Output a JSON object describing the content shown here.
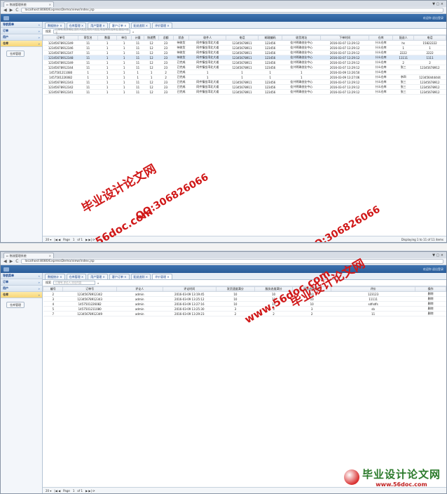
{
  "browser": {
    "tab_title": "物流管理系统",
    "tab_close": "×",
    "win_controls": "▼ ▢ ×",
    "back": "◀",
    "forward": "▶",
    "reload": "C",
    "url": "localhost:8080/ExpressDemo/view/index.jsp"
  },
  "app": {
    "top_right": "欢迎你 退出登录"
  },
  "sidebar": {
    "items": [
      {
        "label": "导航菜单",
        "arrow": "«"
      },
      {
        "label": "订单",
        "arrow": "»"
      },
      {
        "label": "用户",
        "arrow": "»"
      },
      {
        "label": "仓库",
        "arrow": "»"
      }
    ],
    "button": "仓库管理"
  },
  "screen1": {
    "tabs": [
      "数据统计 ×",
      "仓库管理 ×",
      "用户管理 ×",
      "客户订单 ×",
      "配送追踪 ×",
      "评价管理 ×"
    ],
    "search_label": "搜索",
    "search_placeholder": "订单号,收货地址,发件人姓名,收件人姓名,电话号码,仓库名,配送人姓名",
    "columns": [
      "订单号",
      "寄货名",
      "数量",
      "单位",
      "计量",
      "快递费",
      "总额",
      "状态",
      "收件人",
      "电话",
      "邮政编码",
      "收货地址",
      "下单时间",
      "仓库",
      "配送人",
      "电话"
    ],
    "rows": [
      [
        "12345678912349",
        "11",
        "1",
        "1",
        "11",
        "12",
        "23",
        "待收货",
        "同齐镇金湾北大道",
        "12345678911",
        "123456",
        "佳兴明珠创业中心 ",
        "2016-03-07 13:29:12",
        "什么仓库",
        "hs",
        "15822222"
      ],
      [
        "12345678912346",
        "11",
        "1",
        "1",
        "11",
        "12",
        "23",
        "待收货",
        "同齐镇金湾北大道",
        "12345678911",
        "123456",
        "佳兴明珠创业中心 ",
        "2016-03-07 13:29:12",
        "什么仓库",
        "1",
        "1"
      ],
      [
        "12345678912347",
        "11",
        "1",
        "1",
        "11",
        "12",
        "23",
        "待收货",
        "同齐镇金湾北大道",
        "12345678911",
        "123456",
        "佳兴明珠创业中心 ",
        "2016-03-07 13:29:12",
        "什么仓库",
        "2222",
        "2222"
      ],
      [
        "12345678912348",
        "11",
        "1",
        "1",
        "11",
        "12",
        "23",
        "待收货",
        "同齐镇金湾北大道",
        "12345678911",
        "123456",
        "佳兴明珠创业中心 ",
        "2016-03-07 13:29:12",
        "什么仓库",
        "11111",
        "1111"
      ],
      [
        "12345678912349",
        "11",
        "1",
        "1",
        "11",
        "12",
        "23",
        "已完成",
        "同齐镇金湾北大道",
        "12345678911",
        "123456",
        "佳兴明珠创业中心 ",
        "2016-03-07 13:29:12",
        "什么仓库",
        "2",
        "2"
      ],
      [
        "12345678912344",
        "11",
        "1",
        "1",
        "11",
        "12",
        "23",
        "已完成",
        "同齐镇金湾北大道",
        "12345678911",
        "123456",
        "佳兴明珠创业中心 ",
        "2016-03-07 13:29:12",
        "什么仓库",
        "张三",
        "12345678912"
      ],
      [
        "1457501211080",
        "1",
        "1",
        "1",
        "1",
        "1",
        "2",
        "已完成",
        "1",
        "1",
        "1",
        "1",
        "2016-03-09 13:26:50",
        "什么仓库",
        "",
        ""
      ],
      [
        "1457501226082",
        "1",
        "1",
        "1",
        "1",
        "1",
        "2",
        "已完成",
        "1",
        "1",
        "1",
        "1",
        "2016-03-09 13:27:06",
        "什么仓库",
        "李四",
        "123456444444"
      ],
      [
        "12345678912343",
        "11",
        "1",
        "1",
        "11",
        "12",
        "23",
        "已完成",
        "同齐镇金湾北大道",
        "12345678911",
        "123456",
        "佳兴明珠创业中心 ",
        "2016-03-07 13:29:12",
        "什么仓库",
        "张三",
        "12345678912"
      ],
      [
        "12345678912342",
        "11",
        "1",
        "1",
        "11",
        "12",
        "23",
        "已完成",
        "同齐镇金湾北大道",
        "12345678911",
        "123456",
        "佳兴明珠创业中心 ",
        "2016-03-07 13:29:12",
        "什么仓库",
        "张三",
        "12345678912"
      ],
      [
        "12345678912341",
        "11",
        "1",
        "1",
        "11",
        "12",
        "23",
        "已完成",
        "同齐镇金湾北大道",
        "12345678911",
        "123456",
        "佳兴明珠创业中心 ",
        "2016-03-07 13:29:12",
        "什么仓库",
        "张三",
        "12345678912"
      ]
    ],
    "pager": {
      "size": "20 ▾",
      "nav": "|◀ ◀",
      "page_label": "Page",
      "page_value": "1",
      "of": "of 1",
      "nav2": "▶ ▶| ⟳",
      "display": "Displaying 1 to 11 of 11 items"
    }
  },
  "screen2": {
    "tabs": [
      "数据统计 ×",
      "仓库管理 ×",
      "用户管理 ×",
      "客户订单 ×",
      "配送追踪 ×",
      "评价管理 ×"
    ],
    "search_label": "搜索",
    "search_placeholder": "订单号,评论人,评论内容",
    "columns": [
      "编号",
      "订单号",
      "评论人",
      "评论时间",
      "发货速度满分",
      "服务态度满分",
      "服务态度满分",
      "评价",
      "操作"
    ],
    "rows": [
      [
        "2",
        "12345678912342",
        "admin",
        "2016-03-09 13:19:45",
        "10",
        "10",
        "10",
        "123123",
        "删除"
      ],
      [
        "3",
        "12345678912343",
        "admin",
        "2016-03-09 13:25:12",
        "10",
        "10",
        "10",
        "11111",
        "删除"
      ],
      [
        "4",
        "1457501226082",
        "admin",
        "2016-03-09 13:27:16",
        "10",
        "10",
        "10",
        "sdfsdfs",
        "删除"
      ],
      [
        "5",
        "1457501211080",
        "admin",
        "2016-03-09 13:25:30",
        "3",
        "3",
        "3",
        "sb",
        "删除"
      ],
      [
        "7",
        "12345678912349",
        "admin",
        "2016-03-09 13:29:23",
        "2",
        "2",
        "2",
        "11",
        "删除"
      ]
    ],
    "pager": {
      "size": "20 ▾",
      "nav": "|◀ ◀",
      "page_label": "Page",
      "page_value": "1",
      "of": "of 1",
      "nav2": "▶ ▶| ⟳"
    }
  },
  "watermarks": {
    "title": "毕业设计论文网",
    "site": "www.56doc.com",
    "qq": "QQ:306826066",
    "logo_cn": "毕业设计论文网",
    "logo_url": "www.56doc.com"
  }
}
